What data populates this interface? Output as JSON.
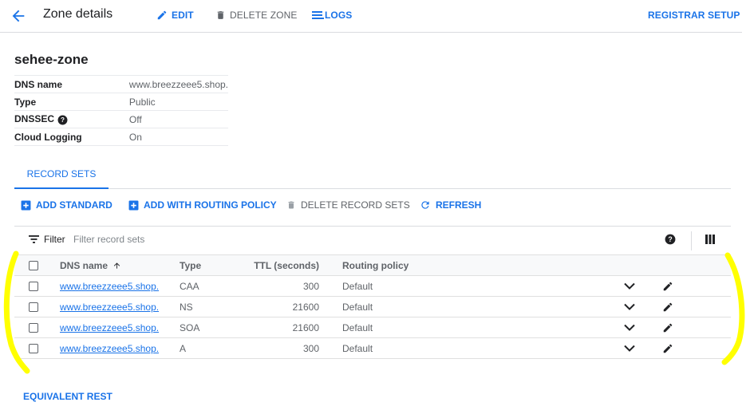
{
  "header": {
    "title": "Zone details",
    "edit_label": "EDIT",
    "delete_zone_label": "DELETE ZONE",
    "logs_label": "LOGS",
    "registrar_label": "REGISTRAR SETUP"
  },
  "zone": {
    "name": "sehee-zone",
    "details": [
      {
        "key": "DNS name",
        "value": "www.breezzeee5.shop."
      },
      {
        "key": "Type",
        "value": "Public"
      },
      {
        "key": "DNSSEC",
        "value": "Off"
      },
      {
        "key": "Cloud Logging",
        "value": "On"
      }
    ]
  },
  "tabs": [
    {
      "label": "RECORD SETS"
    }
  ],
  "actions": {
    "add_standard": "ADD STANDARD",
    "add_routing": "ADD WITH ROUTING POLICY",
    "delete_sets": "DELETE RECORD SETS",
    "refresh": "REFRESH"
  },
  "filter": {
    "label": "Filter",
    "placeholder": "Filter record sets"
  },
  "table": {
    "columns": {
      "dns_name": "DNS name",
      "type": "Type",
      "ttl": "TTL (seconds)",
      "policy": "Routing policy"
    },
    "rows": [
      {
        "dns_name": "www.breezzeee5.shop.",
        "type": "CAA",
        "ttl": "300",
        "policy": "Default"
      },
      {
        "dns_name": "www.breezzeee5.shop.",
        "type": "NS",
        "ttl": "21600",
        "policy": "Default"
      },
      {
        "dns_name": "www.breezzeee5.shop.",
        "type": "SOA",
        "ttl": "21600",
        "policy": "Default"
      },
      {
        "dns_name": "www.breezzeee5.shop.",
        "type": "A",
        "ttl": "300",
        "policy": "Default"
      }
    ]
  },
  "footer": {
    "equivalent_rest": "EQUIVALENT REST"
  },
  "colors": {
    "accent": "#1a73e8",
    "annotation": "#ffff00"
  },
  "icons": [
    "arrow-back-icon",
    "pencil-icon",
    "trash-icon",
    "logs-icon",
    "add-box-icon",
    "refresh-icon",
    "filter-icon",
    "help-icon",
    "column-display-icon",
    "sort-arrow-up-icon",
    "chevron-down-icon"
  ]
}
